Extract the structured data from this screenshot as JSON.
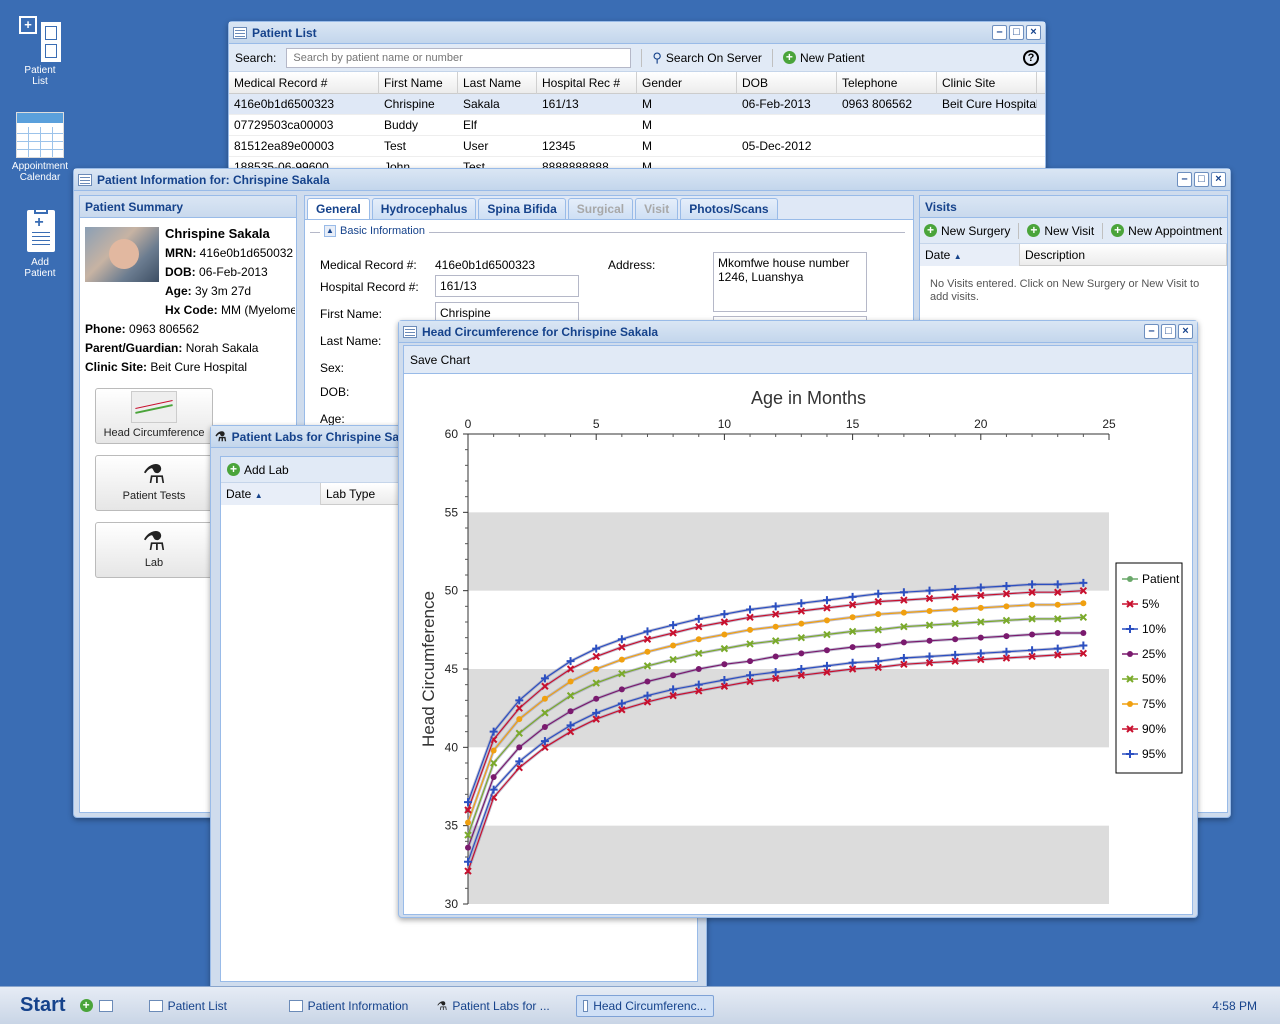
{
  "desktop": {
    "icons": [
      {
        "label_line1": "Patient",
        "label_line2": "List",
        "icon": "patient-list-icon"
      },
      {
        "label_line1": "Appointment",
        "label_line2": "Calendar",
        "icon": "calendar-icon"
      },
      {
        "label_line1": "Add",
        "label_line2": "Patient",
        "icon": "add-patient-icon"
      }
    ]
  },
  "patient_list": {
    "title": "Patient List",
    "search_label": "Search:",
    "search_placeholder": "Search by patient name or number",
    "search_server": "Search On Server",
    "new_patient": "New Patient",
    "help": "?",
    "columns": [
      "Medical Record #",
      "First Name",
      "Last Name",
      "Hospital Rec #",
      "Gender",
      "DOB",
      "Telephone",
      "Clinic Site"
    ],
    "rows": [
      [
        "416e0b1d6500323",
        "Chrispine",
        "Sakala",
        "161/13",
        "M",
        "06-Feb-2013",
        "0963 806562",
        "Beit Cure Hospital"
      ],
      [
        "07729503ca00003",
        "Buddy",
        "Elf",
        "",
        "M",
        "",
        "",
        ""
      ],
      [
        "81512ea89e00003",
        "Test",
        "User",
        "12345",
        "M",
        "05-Dec-2012",
        "",
        ""
      ],
      [
        "188535-06-99600",
        "John",
        "Test",
        "8888888888",
        "M",
        "",
        "",
        ""
      ]
    ]
  },
  "patient_info": {
    "title": "Patient Information for: Chrispine Sakala",
    "summary": {
      "title": "Patient Summary",
      "name": "Chrispine Sakala",
      "mrn_label": "MRN:",
      "mrn": "416e0b1d650032",
      "dob_label": "DOB:",
      "dob": "06-Feb-2013",
      "age_label": "Age:",
      "age": "3y 3m 27d",
      "hx_label": "Hx Code:",
      "hx": "MM (Myelome",
      "phone_label": "Phone:",
      "phone": "0963 806562",
      "guardian_label": "Parent/Guardian:",
      "guardian": "Norah Sakala",
      "clinic_label": "Clinic Site:",
      "clinic": "Beit Cure Hospital",
      "buttons": [
        "Head Circumference",
        "Patient Tests",
        "Lab"
      ]
    },
    "tabs": [
      "General",
      "Hydrocephalus",
      "Spina Bifida",
      "Surgical",
      "Visit",
      "Photos/Scans"
    ],
    "basic_info": {
      "legend": "Basic Information",
      "medical_record_label": "Medical Record #:",
      "medical_record": "416e0b1d6500323",
      "hospital_record_label": "Hospital Record #:",
      "hospital_record": "161/13",
      "first_name_label": "First Name:",
      "first_name": "Chrispine",
      "last_name_label": "Last Name:",
      "sex_label": "Sex:",
      "dob_label": "DOB:",
      "age_label": "Age:",
      "address_label": "Address:",
      "address": "Mkomfwe house number 1246, Luanshya"
    },
    "visits": {
      "title": "Visits",
      "new_surgery": "New Surgery",
      "new_visit": "New Visit",
      "new_appointment": "New Appointment",
      "col_date": "Date",
      "col_description": "Description",
      "empty": "No Visits entered. Click on New Surgery or New Visit to add visits."
    }
  },
  "patient_labs": {
    "title": "Patient Labs for Chrispine Sakala",
    "add_lab": "Add Lab",
    "col_date": "Date",
    "col_lab_type": "Lab Type"
  },
  "head_chart": {
    "title": "Head Circumference for Chrispine Sakala",
    "save": "Save Chart"
  },
  "chart_data": {
    "type": "line",
    "title": "Age in Months",
    "xlabel": "Age in Months",
    "ylabel": "Head Circumference",
    "xlim": [
      0,
      25
    ],
    "ylim": [
      30,
      60
    ],
    "xticks": [
      0,
      5,
      10,
      15,
      20,
      25
    ],
    "yticks": [
      30,
      35,
      40,
      45,
      50,
      55,
      60
    ],
    "legend_position": "right",
    "x": [
      0,
      1,
      2,
      3,
      4,
      5,
      6,
      7,
      8,
      9,
      10,
      11,
      12,
      13,
      14,
      15,
      16,
      17,
      18,
      19,
      20,
      21,
      22,
      23,
      24
    ],
    "series": [
      {
        "name": "Patient",
        "color": "#6aa86a",
        "marker": "circle",
        "values": []
      },
      {
        "name": "5%",
        "color": "#c8102e",
        "marker": "x",
        "values": [
          32.1,
          36.8,
          38.7,
          40.0,
          41.0,
          41.8,
          42.4,
          42.9,
          43.3,
          43.6,
          43.9,
          44.2,
          44.4,
          44.6,
          44.8,
          45.0,
          45.1,
          45.3,
          45.4,
          45.5,
          45.6,
          45.7,
          45.8,
          45.9,
          46.0
        ]
      },
      {
        "name": "10%",
        "color": "#2b4fc1",
        "marker": "plus",
        "values": [
          32.7,
          37.3,
          39.1,
          40.4,
          41.4,
          42.2,
          42.8,
          43.3,
          43.7,
          44.0,
          44.3,
          44.6,
          44.8,
          45.0,
          45.2,
          45.4,
          45.5,
          45.7,
          45.8,
          45.9,
          46.0,
          46.1,
          46.2,
          46.3,
          46.5
        ]
      },
      {
        "name": "25%",
        "color": "#7a1a6e",
        "marker": "circle",
        "values": [
          33.6,
          38.1,
          40.0,
          41.3,
          42.3,
          43.1,
          43.7,
          44.2,
          44.6,
          45.0,
          45.3,
          45.5,
          45.8,
          46.0,
          46.2,
          46.4,
          46.5,
          46.7,
          46.8,
          46.9,
          47.0,
          47.1,
          47.2,
          47.3,
          47.3
        ]
      },
      {
        "name": "50%",
        "color": "#7aaa2a",
        "marker": "x",
        "values": [
          34.4,
          39.0,
          40.9,
          42.2,
          43.3,
          44.1,
          44.7,
          45.2,
          45.6,
          46.0,
          46.3,
          46.6,
          46.8,
          47.0,
          47.2,
          47.4,
          47.5,
          47.7,
          47.8,
          47.9,
          48.0,
          48.1,
          48.2,
          48.2,
          48.3
        ]
      },
      {
        "name": "75%",
        "color": "#f0a010",
        "marker": "circle",
        "values": [
          35.2,
          39.8,
          41.8,
          43.1,
          44.2,
          45.0,
          45.6,
          46.1,
          46.5,
          46.9,
          47.2,
          47.5,
          47.7,
          47.9,
          48.1,
          48.3,
          48.5,
          48.6,
          48.7,
          48.8,
          48.9,
          49.0,
          49.1,
          49.1,
          49.2
        ]
      },
      {
        "name": "90%",
        "color": "#c8102e",
        "marker": "x",
        "values": [
          36.0,
          40.5,
          42.5,
          43.9,
          45.0,
          45.8,
          46.4,
          46.9,
          47.3,
          47.7,
          48.0,
          48.3,
          48.5,
          48.7,
          48.9,
          49.1,
          49.3,
          49.4,
          49.5,
          49.6,
          49.7,
          49.8,
          49.9,
          49.9,
          50.0
        ]
      },
      {
        "name": "95%",
        "color": "#2b4fc1",
        "marker": "plus",
        "values": [
          36.5,
          41.0,
          43.0,
          44.4,
          45.5,
          46.3,
          46.9,
          47.4,
          47.8,
          48.2,
          48.5,
          48.8,
          49.0,
          49.2,
          49.4,
          49.6,
          49.8,
          49.9,
          50.0,
          50.1,
          50.2,
          50.3,
          50.4,
          50.4,
          50.5
        ]
      }
    ]
  },
  "taskbar": {
    "start": "Start",
    "tasks": [
      "Patient List",
      "Patient Information",
      "Patient Labs for ...",
      "Head Circumferenc..."
    ],
    "time": "4:58 PM"
  }
}
